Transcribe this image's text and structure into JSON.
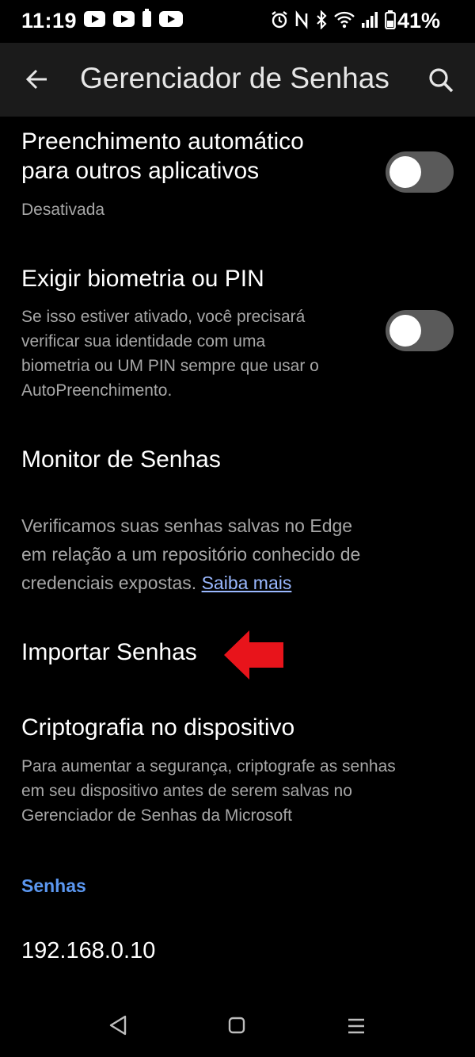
{
  "status_bar": {
    "time": "11:19",
    "battery_percent": "41%",
    "left_icons": [
      "youtube-icon",
      "youtube-icon",
      "battery-saver-icon",
      "video-icon"
    ],
    "right_icons": [
      "alarm-icon",
      "nfc-icon",
      "bluetooth-icon",
      "wifi-icon",
      "signal-icon",
      "battery-icon"
    ]
  },
  "app_bar": {
    "title": "Gerenciador de Senhas",
    "back_icon": "arrow-left-icon",
    "search_icon": "search-icon"
  },
  "settings": {
    "autofill": {
      "title_line1": "Preenchimento automático",
      "title_line2": "para outros aplicativos",
      "subtitle": "Desativada",
      "toggle_on": false
    },
    "biometric": {
      "title": "Exigir biometria ou PIN",
      "desc_line1": "Se isso estiver ativado, você precisará",
      "desc_line2": "verificar sua identidade com uma",
      "desc_line3": "biometria ou UM PIN sempre que usar o",
      "desc_line4": "AutoPreenchimento.",
      "toggle_on": false
    },
    "monitor": {
      "title": "Monitor de Senhas",
      "desc_line1": "Verificamos suas senhas salvas no Edge",
      "desc_line2": "em relação a um repositório conhecido de",
      "desc_line3": "credenciais expostas.",
      "link": "Saiba mais"
    },
    "import": {
      "title": "Importar Senhas"
    },
    "encryption": {
      "title": "Criptografia no dispositivo",
      "desc_line1": "Para aumentar a segurança, criptografe as senhas",
      "desc_line2": "em seu dispositivo antes de serem salvas no",
      "desc_line3": "Gerenciador de Senhas da Microsoft"
    }
  },
  "passwords_section": {
    "header": "Senhas",
    "entries": [
      "192.168.0.10"
    ]
  },
  "annotation_color": "#e8141b",
  "accent_color": "#5b97f0",
  "nav_bar": {
    "icons": [
      "back-triangle-icon",
      "home-square-icon",
      "menu-lines-icon"
    ]
  }
}
